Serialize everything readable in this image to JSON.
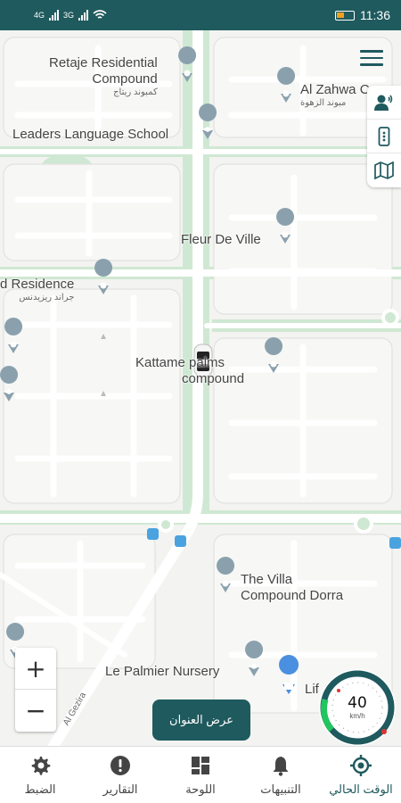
{
  "statusbar": {
    "time": "11:36",
    "sim1": "4G",
    "sim2": "3G",
    "battery_text": "15"
  },
  "map": {
    "pois": [
      {
        "name": "Retaje Residential Compound",
        "line1": "Retaje Residential",
        "line2": "Compound",
        "sub": "كمبوند ريتاج"
      },
      {
        "name": "Al Zahwa",
        "line1": "Al Zahwa Com",
        "sub": "مبوند الزهوة"
      },
      {
        "name": "Leaders Language School",
        "line1": "Leaders Language School"
      },
      {
        "name": "Fleur De Ville",
        "line1": "Fleur De Ville"
      },
      {
        "name": "Grand Residence",
        "line1": "d Residence",
        "sub": "جراند ريزيدنس"
      },
      {
        "name": "Kattameya palms",
        "line1": "Kattame   palms",
        "line2": "compound"
      },
      {
        "name": "The Villa Compound Dorra",
        "line1": "The Villa",
        "line2": "Compound Dorra"
      },
      {
        "name": "Le Palmier Nursery",
        "line1": "Le Palmier Nursery"
      },
      {
        "name": "Lif",
        "line1": "Lif"
      }
    ],
    "road_label": "Al Gezira"
  },
  "controls": {
    "zoom_in": "+",
    "zoom_out": "−",
    "address_button": "عرض العنوان"
  },
  "speed": {
    "value": "40",
    "unit": "km/h"
  },
  "nav": [
    {
      "label": "الضبط",
      "icon": "gear-icon"
    },
    {
      "label": "التقارير",
      "icon": "alert-circle-icon"
    },
    {
      "label": "اللوحة",
      "icon": "dashboard-icon"
    },
    {
      "label": "التنبيهات",
      "icon": "bell-icon"
    },
    {
      "label": "الوقت الحالي",
      "icon": "location-target-icon"
    }
  ],
  "colors": {
    "primary": "#1f5a5e",
    "park": "#cfe8d3",
    "road": "#ffffff",
    "land": "#f3f3f1"
  }
}
